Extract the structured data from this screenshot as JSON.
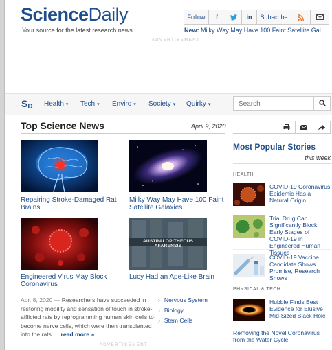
{
  "header": {
    "logo_a": "Science",
    "logo_b": "Daily",
    "tagline": "Your source for the latest research news",
    "social": {
      "follow": "Follow",
      "facebook": "f",
      "linkedin": "in",
      "subscribe": "Subscribe"
    },
    "new_label": "New:",
    "new_title": "Milky Way May Have 100 Faint Satellite Gala…"
  },
  "ad_label": "ADVERTISEMENT",
  "nav": {
    "logo": "S",
    "logo_sub": "D",
    "items": [
      {
        "label": "Health"
      },
      {
        "label": "Tech"
      },
      {
        "label": "Enviro"
      },
      {
        "label": "Society"
      },
      {
        "label": "Quirky"
      }
    ],
    "caret": "▾",
    "search_placeholder": "Search"
  },
  "main": {
    "title": "Top Science News",
    "date": "April 9, 2020",
    "stories": [
      {
        "caption": "Repairing Stroke-Damaged Rat Brains"
      },
      {
        "caption": "Milky Way May Have 100 Faint Satellite Galaxies"
      },
      {
        "caption": "Engineered Virus May Block Coronavirus"
      },
      {
        "caption": "Lucy Had an Ape-Like Brain",
        "image_text": "AUSTRALOPITHECUS AFARENSIS"
      }
    ],
    "summary_date": "Apr. 8, 2020 —",
    "summary_text": "Researchers have succeeded in restoring mobility and sensation of touch in stroke-afflicted rats by reprogramming human skin cells to become nerve cells, which were then transplanted into the rats' ...",
    "read_more": "read more »",
    "topic_chevron": "›",
    "topics": [
      "Nervous System",
      "Biology",
      "Stem Cells"
    ]
  },
  "sidebar": {
    "title": "Most Popular Stories",
    "subtitle": "this week",
    "sections": [
      {
        "label": "HEALTH",
        "items": [
          {
            "title": "COVID-19 Coronavirus Epidemic Has a Natural Origin"
          },
          {
            "title": "Trial Drug Can Significantly Block Early Stages of COVID-19 in Engineered Human Tissues"
          },
          {
            "title": "COVID-19 Vaccine Candidate Shows Promise, Research Shows"
          }
        ]
      },
      {
        "label": "PHYSICAL & TECH",
        "items": [
          {
            "title": "Hubble Finds Best Evidence for Elusive Mid-Sized Black Hole"
          },
          {
            "title": "Removing the Novel Coronavirus from the Water Cycle"
          }
        ]
      }
    ]
  }
}
